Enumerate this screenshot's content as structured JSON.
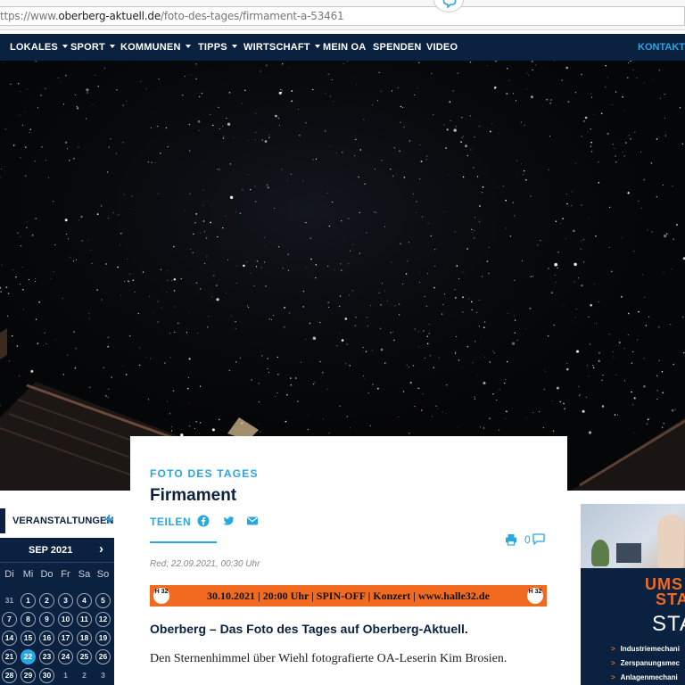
{
  "browser": {
    "url_prefix": "ttps://www.",
    "url_host": "oberberg-aktuell.de",
    "url_path": "/foto-des-tages/firmament-a-53461"
  },
  "nav": {
    "items": [
      {
        "label": "LOKALES",
        "dropdown": true
      },
      {
        "label": "SPORT",
        "dropdown": true
      },
      {
        "label": "KOMMUNEN",
        "dropdown": true
      },
      {
        "label": "TIPPS",
        "dropdown": true
      },
      {
        "label": "WIRTSCHAFT",
        "dropdown": true
      },
      {
        "label": "MEIN OA",
        "dropdown": false
      },
      {
        "label": "SPENDEN",
        "dropdown": false
      },
      {
        "label": "VIDEO",
        "dropdown": false
      }
    ],
    "contact": "KONTAKT"
  },
  "article": {
    "kicker": "FOTO DES TAGES",
    "title": "Firmament",
    "share_label": "TEILEN",
    "share_icons": [
      "facebook-icon",
      "twitter-icon",
      "mail-icon"
    ],
    "comment_count": "0",
    "meta": "Red; 22.09.2021, 00:30 Uhr",
    "banner": "30.10.2021 | 20:00 Uhr | SPIN-OFF | Konzert | www.halle32.de",
    "banner_logo": "H 32",
    "lead": "Oberberg – Das Foto des Tages auf Oberberg-Aktuell.",
    "body": "Den Sternenhimmel über Wiehl fotografierte OA-Leserin Kim Brosien."
  },
  "events": {
    "label": "VERANSTALTUNGEN",
    "plus": "+"
  },
  "calendar": {
    "month": "SEP 2021",
    "next": "›",
    "weekdays": [
      "Di",
      "Mi",
      "Do",
      "Fr",
      "Sa",
      "So"
    ],
    "rows": [
      [
        "31",
        "1",
        "2",
        "3",
        "4",
        "5"
      ],
      [
        "7",
        "8",
        "9",
        "10",
        "11",
        "12"
      ],
      [
        "14",
        "15",
        "16",
        "17",
        "18",
        "19"
      ],
      [
        "21",
        "22",
        "23",
        "24",
        "25",
        "26"
      ],
      [
        "28",
        "29",
        "30",
        "1",
        "2",
        "3"
      ]
    ],
    "today": "22"
  },
  "ad": {
    "title1": "UMS",
    "title2": "STA",
    "title3": "STA",
    "items": [
      "Industriemechani",
      "Zerspanungsmec",
      "Anlagenmechani"
    ]
  },
  "colors": {
    "navy": "#0b2140",
    "accent_blue": "#2aa6e0",
    "banner_orange": "#f26a1f"
  }
}
